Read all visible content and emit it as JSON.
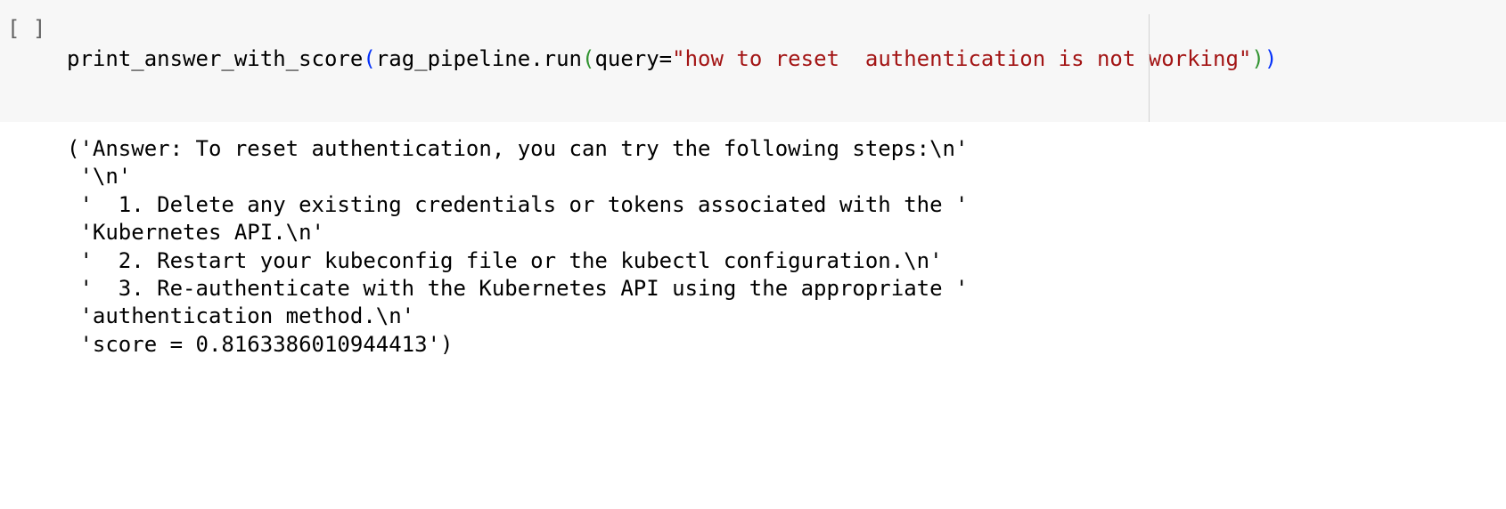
{
  "cell": {
    "execution_count": "[ ]",
    "code": {
      "func": "print_answer_with_score",
      "open1": "(",
      "call": "rag_pipeline.run",
      "open2": "(",
      "kw": "query=",
      "query_string": "\"how to reset  authentication is not working\"",
      "close2": ")",
      "close1": ")"
    },
    "output_lines": [
      "('Answer: To reset authentication, you can try the following steps:\\n'",
      " '\\n'",
      " '  1. Delete any existing credentials or tokens associated with the '",
      " 'Kubernetes API.\\n'",
      " '  2. Restart your kubeconfig file or the kubectl configuration.\\n'",
      " '  3. Re-authenticate with the Kubernetes API using the appropriate '",
      " 'authentication method.\\n'",
      " 'score = 0.8163386010944413')"
    ]
  },
  "colors": {
    "cell_background": "#f7f7f7",
    "function_paren": "#0431fa",
    "inner_paren": "#319331",
    "string": "#a31515"
  }
}
